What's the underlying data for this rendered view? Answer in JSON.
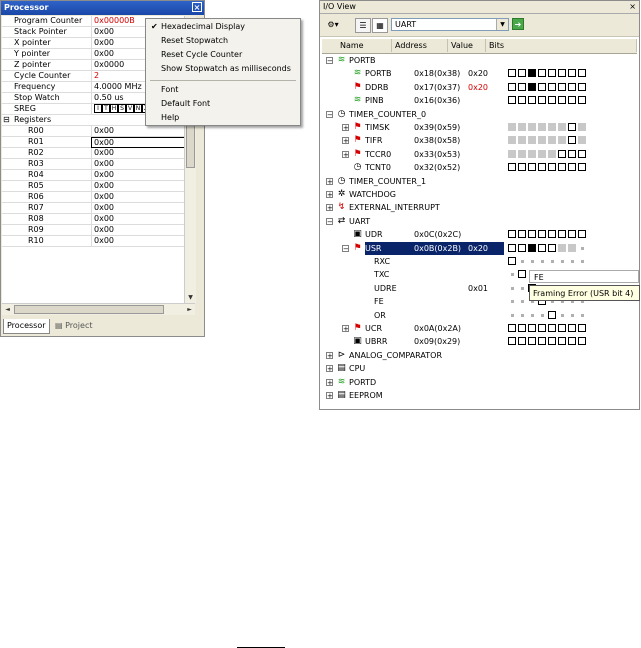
{
  "processor": {
    "title": "Processor",
    "rows": [
      {
        "name": "Program Counter",
        "value": "0x00000B",
        "red": true
      },
      {
        "name": "Stack Pointer",
        "value": "0x00"
      },
      {
        "name": "X pointer",
        "value": "0x00"
      },
      {
        "name": "Y pointer",
        "value": "0x00"
      },
      {
        "name": "Z pointer",
        "value": "0x0000"
      },
      {
        "name": "Cycle Counter",
        "value": "2",
        "red": true
      },
      {
        "name": "Frequency",
        "value": "4.0000 MHz"
      },
      {
        "name": "Stop Watch",
        "value": "0.50 us"
      }
    ],
    "sreg_label": "SREG",
    "sreg_flags": [
      "I",
      "T",
      "H",
      "S",
      "V",
      "N",
      "Z",
      "C"
    ],
    "registers_label": "Registers",
    "registers": [
      {
        "name": "R00",
        "value": "0x00"
      },
      {
        "name": "R01",
        "value": "0x00"
      },
      {
        "name": "R02",
        "value": "0x00"
      },
      {
        "name": "R03",
        "value": "0x00"
      },
      {
        "name": "R04",
        "value": "0x00"
      },
      {
        "name": "R05",
        "value": "0x00"
      },
      {
        "name": "R06",
        "value": "0x00"
      },
      {
        "name": "R07",
        "value": "0x00"
      },
      {
        "name": "R08",
        "value": "0x00"
      },
      {
        "name": "R09",
        "value": "0x00"
      },
      {
        "name": "R10",
        "value": "0x00"
      }
    ],
    "tabs": [
      "Processor",
      "Project"
    ]
  },
  "context_menu": {
    "items_top": [
      {
        "label": "Hexadecimal Display",
        "checked": true
      },
      {
        "label": "Reset Stopwatch"
      },
      {
        "label": "Reset Cycle Counter"
      },
      {
        "label": "Show Stopwatch as milliseconds"
      }
    ],
    "items_bottom": [
      {
        "label": "Font"
      },
      {
        "label": "Default Font"
      },
      {
        "label": "Help"
      }
    ]
  },
  "io_view": {
    "title": "I/O View",
    "selected_module": "UART",
    "columns": [
      "Name",
      "Address",
      "Value",
      "Bits"
    ],
    "rows": [
      {
        "level": 0,
        "toggle": "−",
        "icon": "port-icon",
        "name": "PORTB"
      },
      {
        "level": 1,
        "icon": "port-icon",
        "name": "PORTB",
        "address": "0x18(0x38)",
        "value": "0x20",
        "bits": "ooXooooo"
      },
      {
        "level": 1,
        "icon": "flag-icon",
        "name": "DDRB",
        "address": "0x17(0x37)",
        "value": "0x20",
        "value_red": true,
        "bits": "ooXooooo"
      },
      {
        "level": 1,
        "icon": "port-icon",
        "name": "PINB",
        "address": "0x16(0x36)",
        "value": "",
        "bits": "oooooooo"
      },
      {
        "level": 0,
        "toggle": "−",
        "icon": "timer-icon",
        "name": "TIMER_COUNTER_0"
      },
      {
        "level": 1,
        "toggle": "+",
        "icon": "flag-icon",
        "name": "TIMSK",
        "address": "0x39(0x59)",
        "value": "",
        "bits": "ggggggog"
      },
      {
        "level": 1,
        "toggle": "+",
        "icon": "flag-icon",
        "name": "TIFR",
        "address": "0x38(0x58)",
        "value": "",
        "bits": "ggggggog"
      },
      {
        "level": 1,
        "toggle": "+",
        "icon": "flag-icon",
        "name": "TCCR0",
        "address": "0x33(0x53)",
        "value": "",
        "bits": "gggggooo"
      },
      {
        "level": 1,
        "icon": "timer-icon",
        "name": "TCNT0",
        "address": "0x32(0x52)",
        "value": "",
        "bits": "oooooooo"
      },
      {
        "level": 0,
        "toggle": "+",
        "icon": "timer-icon",
        "name": "TIMER_COUNTER_1"
      },
      {
        "level": 0,
        "toggle": "+",
        "icon": "watchdog-icon",
        "name": "WATCHDOG"
      },
      {
        "level": 0,
        "toggle": "+",
        "icon": "interrupt-icon",
        "name": "EXTERNAL_INTERRUPT"
      },
      {
        "level": 0,
        "toggle": "−",
        "icon": "uart-icon",
        "name": "UART"
      },
      {
        "level": 1,
        "icon": "register-icon",
        "name": "UDR",
        "address": "0x0C(0x2C)",
        "value": "",
        "bits": "oooooooo"
      },
      {
        "level": 1,
        "toggle": "−",
        "icon": "flag-icon",
        "name": "USR",
        "address": "0x0B(0x2B)",
        "value": "0x20",
        "bits": "ooXoogg.",
        "selected": true
      },
      {
        "level": 2,
        "name": "RXC",
        "bits": "o......."
      },
      {
        "level": 2,
        "name": "TXC",
        "bits": ".o......"
      },
      {
        "level": 2,
        "name": "UDRE",
        "value": "0x01",
        "bits": "..X....."
      },
      {
        "level": 2,
        "name": "FE",
        "bits": "...o...."
      },
      {
        "level": 2,
        "name": "OR",
        "bits": "....o..."
      },
      {
        "level": 1,
        "toggle": "+",
        "icon": "flag-icon",
        "name": "UCR",
        "address": "0x0A(0x2A)",
        "value": "",
        "bits": "oooooooo"
      },
      {
        "level": 1,
        "icon": "register-icon",
        "name": "UBRR",
        "address": "0x09(0x29)",
        "value": "",
        "bits": "oooooooo"
      },
      {
        "level": 0,
        "toggle": "+",
        "icon": "comparator-icon",
        "name": "ANALOG_COMPARATOR"
      },
      {
        "level": 0,
        "toggle": "+",
        "icon": "cpu-icon",
        "name": "CPU"
      },
      {
        "level": 0,
        "toggle": "+",
        "icon": "port-icon",
        "name": "PORTD"
      },
      {
        "level": 0,
        "toggle": "+",
        "icon": "eeprom-icon",
        "name": "EEPROM"
      }
    ],
    "tooltip_title": "FE",
    "tooltip_text": "Framing Error  (USR bit 4)"
  },
  "colors": {
    "selection": "#0a246a",
    "changed_value": "#d40000",
    "panel_bg": "#ece9d8"
  }
}
